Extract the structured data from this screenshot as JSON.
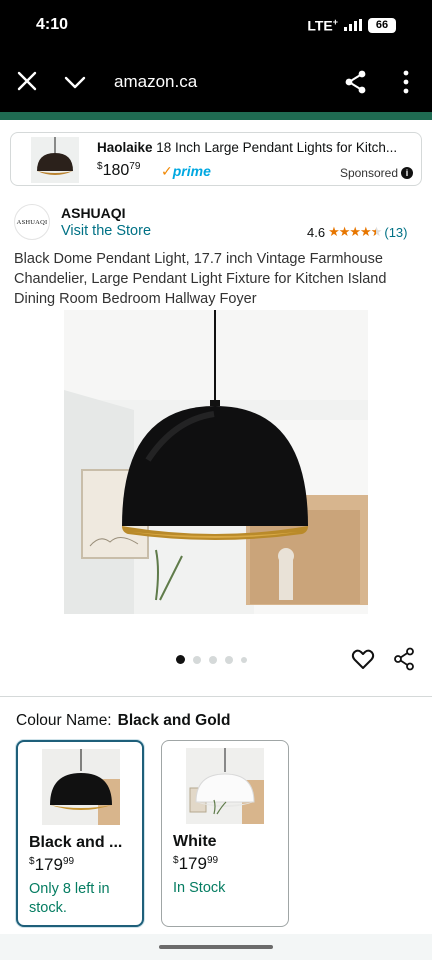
{
  "status_bar": {
    "time": "4:10",
    "network": "LTE",
    "network_sup": "+",
    "battery": "66"
  },
  "browser": {
    "url": "amazon.ca"
  },
  "ad": {
    "brand": "Haolaike",
    "title_rest": " 18 Inch Large Pendant Lights for Kitch...",
    "currency": "$",
    "price_whole": "180",
    "price_fraction": "79",
    "prime_label": "prime",
    "sponsored_label": "Sponsored",
    "info_glyph": "i"
  },
  "brand": {
    "logo_text": "ASHUAQI",
    "name": "ASHUAQI",
    "store_link": "Visit the Store"
  },
  "rating": {
    "value": "4.6",
    "stars": 4.5,
    "count": "(13)"
  },
  "product_title": "Black Dome Pendant Light, 17.7 inch Vintage Farmhouse Chandelier, Large Pendant Light Fixture for Kitchen Island Dining Room Bedroom Hallway Foyer",
  "image_carousel": {
    "total": 5,
    "active_index": 0
  },
  "variation": {
    "label": "Colour Name:",
    "selected": "Black and Gold",
    "options": [
      {
        "name": "Black and ...",
        "currency": "$",
        "price_whole": "179",
        "price_fraction": "99",
        "stock": "Only 8 left in stock.",
        "selected": true
      },
      {
        "name": "White",
        "currency": "$",
        "price_whole": "179",
        "price_fraction": "99",
        "stock": "In Stock",
        "selected": false
      }
    ]
  },
  "colors": {
    "link": "#007185",
    "stock_green": "#067d62",
    "star": "#e77600",
    "prime_blue": "#00a8e1",
    "header_green": "#1f6b52",
    "selected_border": "#1e5f7a"
  }
}
